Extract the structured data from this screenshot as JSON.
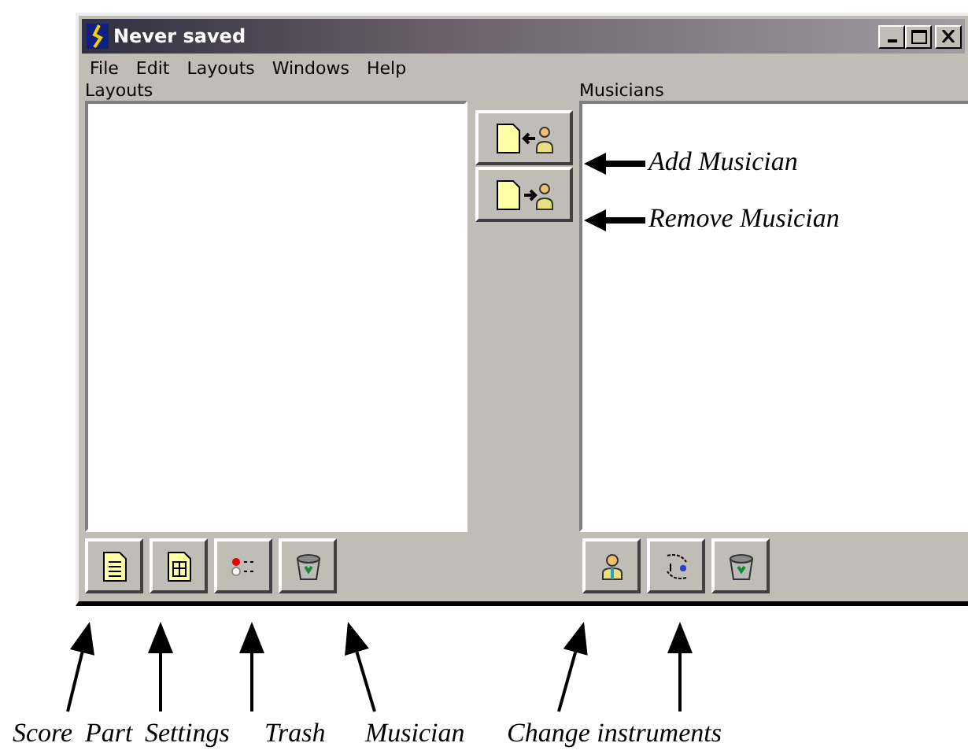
{
  "window": {
    "title": "Never saved"
  },
  "menu": [
    {
      "label": "File"
    },
    {
      "label": "Edit"
    },
    {
      "label": "Layouts"
    },
    {
      "label": "Windows"
    },
    {
      "label": "Help"
    }
  ],
  "layouts_panel": {
    "label": "Layouts"
  },
  "musicians_panel": {
    "label": "Musicians"
  },
  "annotations": [
    {
      "text": "Add Musician",
      "kind": "side"
    },
    {
      "text": "Remove Musician",
      "kind": "side"
    },
    {
      "text": "Score",
      "kind": "below"
    },
    {
      "text": "Part",
      "kind": "below"
    },
    {
      "text": "Settings",
      "kind": "below"
    },
    {
      "text": "Trash",
      "kind": "below"
    },
    {
      "text": "Musician",
      "kind": "below"
    },
    {
      "text": "Change instruments",
      "kind": "below"
    }
  ]
}
